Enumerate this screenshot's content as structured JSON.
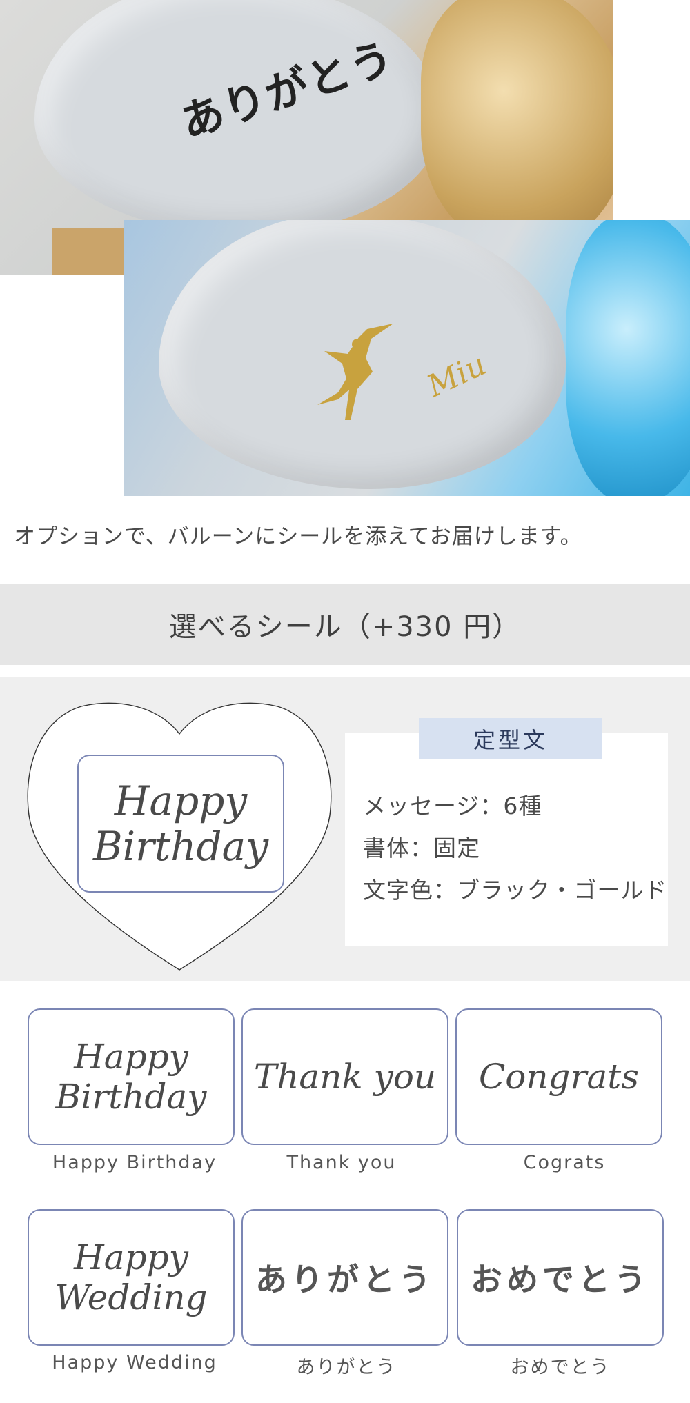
{
  "photos": {
    "photo1": {
      "balloon_text": "ありがとう"
    },
    "photo2": {
      "balloon_text": "Miu"
    }
  },
  "caption": "オプションで、バルーンにシールを添えてお届けします。",
  "section_header": "選べるシール（+330 円）",
  "feature": {
    "sticker_text": "Happy Birthday",
    "tag": "定型文",
    "lines": [
      "メッセージ：6種",
      "書体：固定",
      "文字色：ブラック・ゴールド"
    ]
  },
  "stickers": [
    {
      "text": "Happy Birthday",
      "label": "Happy Birthday"
    },
    {
      "text": "Thank you",
      "label": "Thank you"
    },
    {
      "text": "Congrats",
      "label": "Cograts"
    },
    {
      "text": "Happy Wedding",
      "label": "Happy Wedding"
    },
    {
      "text": "ありがとう",
      "label": "ありがとう"
    },
    {
      "text": "おめでとう",
      "label": "おめでとう"
    }
  ],
  "colors": {
    "sticker_border": "#7b86b4",
    "tag_background": "#d7e1f1",
    "header_background": "#e6e6e6",
    "feature_background": "#efefef"
  }
}
